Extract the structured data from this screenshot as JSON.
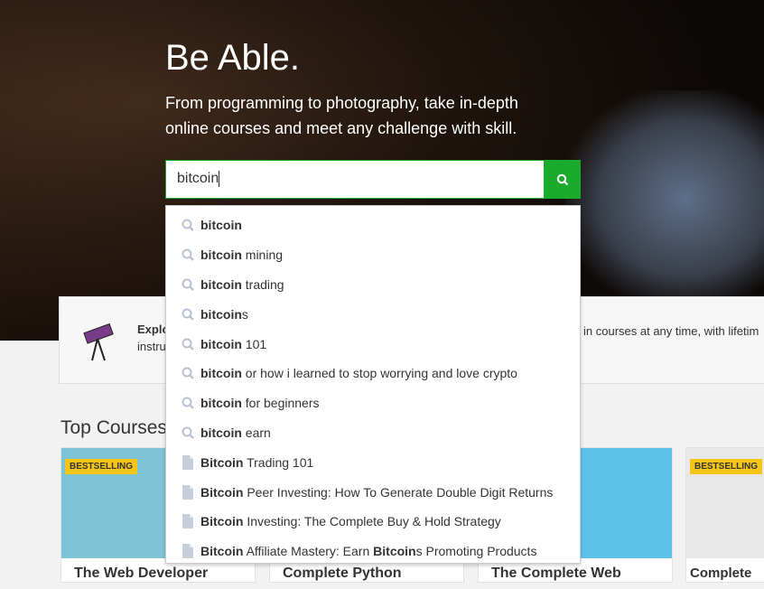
{
  "hero": {
    "title": "Be Able.",
    "subtitle": "From programming to photography, take in-depth online courses and meet any challenge with skill."
  },
  "search": {
    "value": "bitcoin",
    "button_icon": "search-icon",
    "accent": "#1aab2c"
  },
  "suggestions": [
    {
      "type": "query",
      "bold": "bitcoin",
      "rest": ""
    },
    {
      "type": "query",
      "bold": "bitcoin",
      "rest": " mining"
    },
    {
      "type": "query",
      "bold": "bitcoin",
      "rest": " trading"
    },
    {
      "type": "query",
      "bold": "bitcoin",
      "rest": "s"
    },
    {
      "type": "query",
      "bold": "bitcoin",
      "rest": " 101"
    },
    {
      "type": "query",
      "bold": "bitcoin",
      "rest": " or how i learned to stop worrying and love crypto"
    },
    {
      "type": "query",
      "bold": "bitcoin",
      "rest": " for beginners"
    },
    {
      "type": "query",
      "bold": "bitcoin",
      "rest": " earn"
    },
    {
      "type": "course",
      "bold": "Bitcoin",
      "rest": " Trading 101"
    },
    {
      "type": "course",
      "bold": "Bitcoin",
      "rest": " Peer Investing: How To Generate Double Digit Returns"
    },
    {
      "type": "course",
      "bold": "Bitcoin",
      "rest": " Investing: The Complete Buy & Hold Strategy"
    },
    {
      "type": "course",
      "bold": "Bitcoin",
      "rest": " Affiliate Mastery: Earn ",
      "bold2": "Bitcoin",
      "rest2": "s Promoting Products"
    }
  ],
  "info": {
    "left_title": "Explo",
    "left_text": "instru",
    "right_text": "in courses at any time, with lifetim"
  },
  "top_courses": {
    "heading": "Top Courses",
    "cards": [
      {
        "title": "The Web Developer",
        "badge": "BESTSELLING",
        "color": "#7fc3d6"
      },
      {
        "title": "Complete Python",
        "badge": "",
        "color": "#3a6f8f"
      },
      {
        "title": "The Complete Web",
        "badge": "",
        "color": "#5cc3e8"
      },
      {
        "title": "Complete",
        "badge": "BESTSELLING",
        "color": "#e8e8e8"
      }
    ]
  }
}
